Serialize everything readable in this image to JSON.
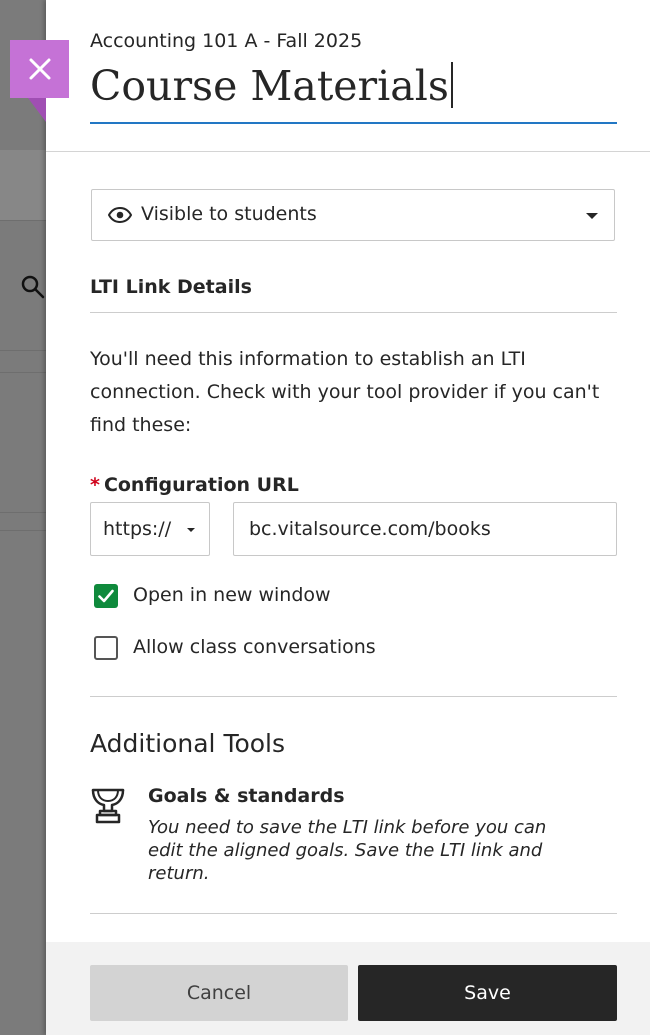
{
  "panel": {
    "course_name": "Accounting 101 A - Fall 2025",
    "title_value": "Course Materials"
  },
  "visibility": {
    "label": "Visible to students",
    "icon": "eye-icon"
  },
  "lti": {
    "section_title": "LTI Link Details",
    "info_text": "You'll need this information to establish an LTI connection. Check with your tool provider if you can't find these:",
    "required_marker": "*",
    "config_label": "Configuration URL",
    "protocol": "https://",
    "url_value": "bc.vitalsource.com/books",
    "open_new_window": {
      "label": "Open in new window",
      "checked": true
    },
    "allow_conversations": {
      "label": "Allow class conversations",
      "checked": false
    }
  },
  "additional_tools": {
    "title": "Additional Tools",
    "goals": {
      "icon": "trophy-icon",
      "title": "Goals & standards",
      "description": "You need to save the LTI link before you can edit the aligned goals. Save the LTI link and return."
    }
  },
  "footer": {
    "cancel_label": "Cancel",
    "save_label": "Save"
  },
  "colors": {
    "accent_purple": "#c572d6",
    "focus_blue": "#2277c4",
    "check_green": "#0f8a3c",
    "required_red": "#d0021b",
    "save_button": "#262626"
  }
}
